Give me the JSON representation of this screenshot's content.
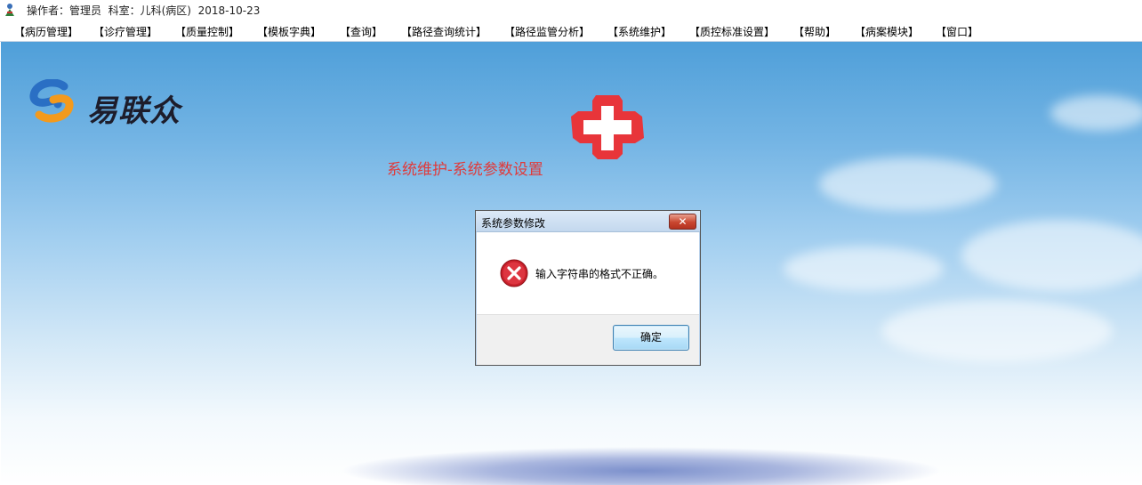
{
  "window": {
    "title": "操作者：管理员  科室：儿科(病区)  2018-10-23"
  },
  "menu": [
    {
      "label": "【病历管理】"
    },
    {
      "label": "【诊疗管理】"
    },
    {
      "label": "【质量控制】"
    },
    {
      "label": "【模板字典】"
    },
    {
      "label": "【查询】"
    },
    {
      "label": "【路径查询统计】"
    },
    {
      "label": "【路径监管分析】"
    },
    {
      "label": "【系统维护】"
    },
    {
      "label": "【质控标准设置】"
    },
    {
      "label": "【帮助】"
    },
    {
      "label": "【病案模块】"
    },
    {
      "label": "【窗口】"
    }
  ],
  "branding": {
    "logo_text": "易联众",
    "cross_color": "#e8353a"
  },
  "page": {
    "heading": "系统维护-系统参数设置"
  },
  "dialog": {
    "title": "系统参数修改",
    "close_label": "✕",
    "message": "输入字符串的格式不正确。",
    "ok_label": "确定",
    "icon": "error-icon"
  },
  "colors": {
    "sky_top": "#4f9fd9",
    "heading_red": "#e03a3a"
  }
}
